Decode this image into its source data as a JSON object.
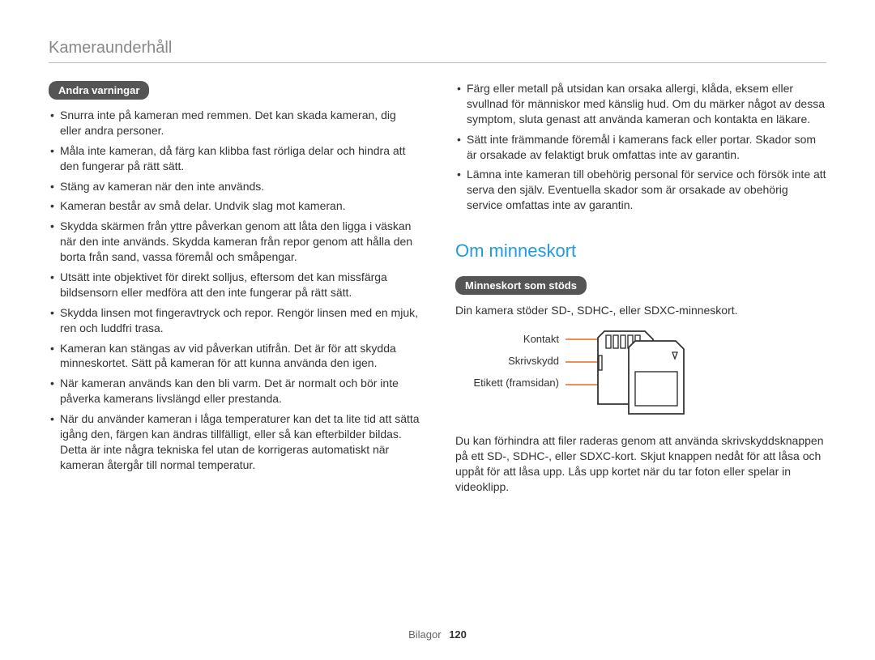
{
  "header": {
    "title": "Kameraunderhåll"
  },
  "left": {
    "pill": "Andra varningar",
    "items": [
      "Snurra inte på kameran med remmen. Det kan skada kameran, dig eller andra personer.",
      "Måla inte kameran, då färg kan klibba fast rörliga delar och hindra att den fungerar på rätt sätt.",
      "Stäng av kameran när den inte används.",
      "Kameran består av små delar. Undvik slag mot kameran.",
      "Skydda skärmen från yttre påverkan genom att låta den ligga i väskan när den inte används. Skydda kameran från repor genom att hålla den borta från sand, vassa föremål och småpengar.",
      "Utsätt inte objektivet för direkt solljus, eftersom det kan missfärga bildsensorn eller medföra att den inte fungerar på rätt sätt.",
      "Skydda linsen mot fingeravtryck och repor. Rengör linsen med en mjuk, ren och luddfri trasa.",
      "Kameran kan stängas av vid påverkan utifrån. Det är för att skydda minneskortet. Sätt på kameran för att kunna använda den igen.",
      "När kameran används kan den bli varm. Det är normalt och bör inte påverka kamerans livslängd eller prestanda.",
      "När du använder kameran i låga temperaturer kan det ta lite tid att sätta igång den, färgen kan ändras tillfälligt, eller så kan efterbilder bildas. Detta är inte några tekniska fel utan de korrigeras automatiskt när kameran återgår till normal temperatur."
    ]
  },
  "right_top": {
    "items": [
      "Färg eller metall på utsidan kan orsaka allergi, klåda, eksem eller svullnad för människor med känslig hud. Om du märker något av dessa symptom, sluta genast att använda kameran och kontakta en läkare.",
      "Sätt inte främmande föremål i kamerans fack eller portar. Skador som är orsakade av felaktigt bruk omfattas inte av garantin.",
      "Lämna inte kameran till obehörig personal för service och försök inte att serva den själv. Eventuella skador som är orsakade av obehörig service omfattas inte av garantin."
    ]
  },
  "memory": {
    "heading": "Om minneskort",
    "pill": "Minneskort som stöds",
    "intro": "Din kamera stöder SD-, SDHC-, eller SDXC-minneskort.",
    "labels": {
      "contact": "Kontakt",
      "writeprotect": "Skrivskydd",
      "label_front": "Etikett (framsidan)"
    },
    "outro": "Du kan förhindra att filer raderas genom att använda skrivskyddsknappen på ett SD-, SDHC-, eller SDXC-kort. Skjut knappen nedåt för att låsa och uppåt för att låsa upp. Lås upp kortet när du tar foton eller spelar in videoklipp."
  },
  "footer": {
    "section": "Bilagor",
    "page": "120"
  }
}
